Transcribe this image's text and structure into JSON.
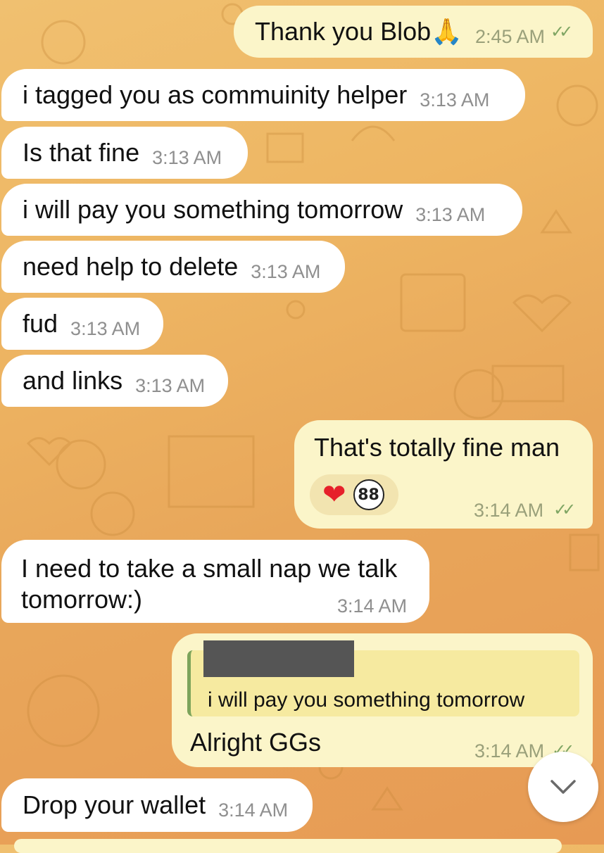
{
  "messages": [
    {
      "text": "Thank you Blob🙏",
      "time": "2:45 AM",
      "ticks": "✓✓"
    },
    {
      "text": "i tagged you as commuinity helper",
      "time": "3:13 AM"
    },
    {
      "text": "Is that fine",
      "time": "3:13 AM"
    },
    {
      "text": "i will pay you something tomorrow",
      "time": "3:13 AM"
    },
    {
      "text": "need help to delete",
      "time": "3:13 AM"
    },
    {
      "text": "fud",
      "time": "3:13 AM"
    },
    {
      "text": "and links",
      "time": "3:13 AM"
    },
    {
      "text": "That's  totally fine man",
      "time": "3:14 AM",
      "ticks": "✓✓",
      "reaction_heart": "❤",
      "reaction_avatar": "88"
    },
    {
      "line1": "I need to take a small nap we talk",
      "line2": "tomorrow:)",
      "time": "3:14 AM"
    },
    {
      "quote": "i will pay you something tomorrow",
      "text": "Alright GGs",
      "time": "3:14 AM",
      "ticks": "✓✓"
    },
    {
      "text": "Drop your wallet",
      "time": "3:14 AM"
    }
  ],
  "scroll_down_icon": "chevron-down-icon",
  "colors": {
    "incoming": "#ffffff",
    "outgoing": "#fbf5c9",
    "tick": "#7fa563",
    "quote_bar": "#7da45b"
  }
}
